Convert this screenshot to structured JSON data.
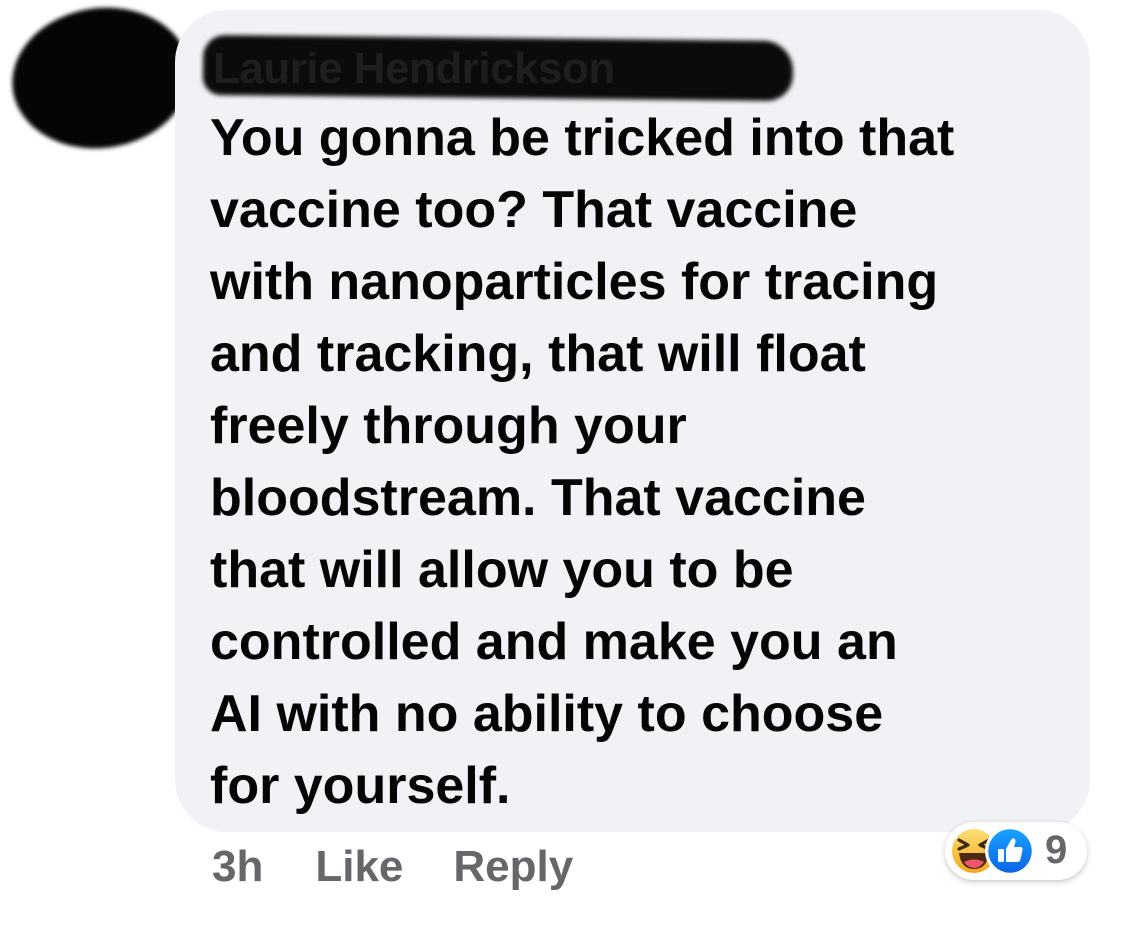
{
  "comment": {
    "author": "Laurie Hendrickson",
    "text": "You gonna be tricked into that vaccine too? That vaccine with nanoparticles for tracing and tracking, that will float freely through your bloodstream. That vaccine that will allow you to be controlled and make you an AI with no ability to choose for yourself.",
    "lines": [
      "You gonna be tricked into that",
      "vaccine too? That vaccine",
      "with nanoparticles for tracing",
      "and tracking, that will float",
      "freely through your",
      "bloodstream. That vaccine",
      "that will allow you to be",
      "controlled and make you an",
      "AI with no ability to choose",
      "for yourself."
    ]
  },
  "actions": {
    "time": "3h",
    "like_label": "Like",
    "reply_label": "Reply"
  },
  "reactions": {
    "icons": [
      "haha-icon",
      "like-thumb-icon"
    ],
    "count": "9"
  },
  "colors": {
    "bubble": "#f0f2f5",
    "text": "#050505",
    "meta": "#65676b",
    "like_blue": "#1877f2",
    "haha_yellow": "#f7b928"
  }
}
